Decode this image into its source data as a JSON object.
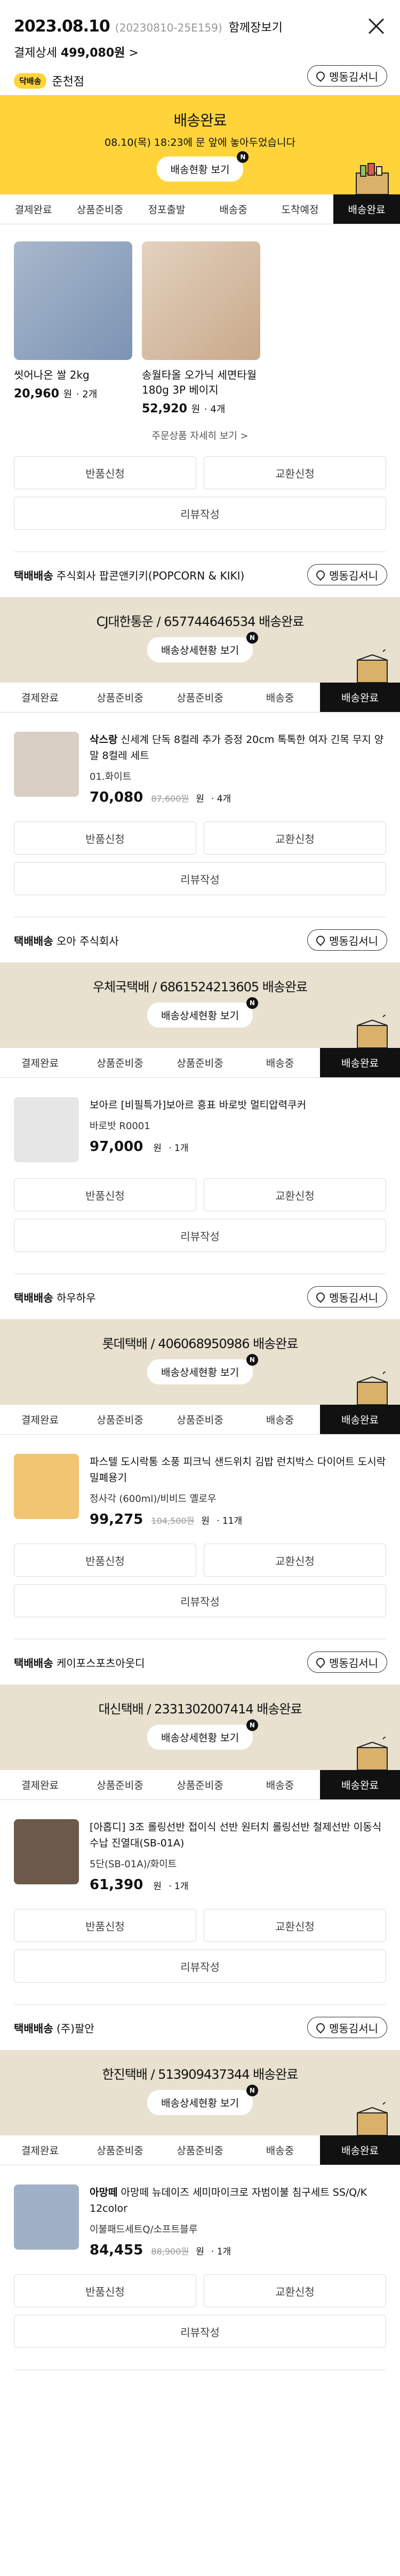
{
  "header": {
    "date": "2023.08.10",
    "order_code": "(20230810-25E159)",
    "together_link": "함께장보기",
    "pay_label": "결제상세",
    "pay_amount": "499,080원",
    "pay_arrow": ">",
    "shop_badge": "닥배송",
    "shop_name": "준천점",
    "map_btn": "멩동김서니"
  },
  "status_main": {
    "title": "배송완료",
    "desc": "08.10(목) 18:23에 문 앞에 놓아두었습니다",
    "button": "배송현황 보기",
    "badge": "N"
  },
  "tabs": [
    "결제완료",
    "상품준비중",
    "정포출발",
    "배송중",
    "도착예정",
    "배송완료"
  ],
  "store_products": [
    {
      "name": "씻어나온 쌀 2kg",
      "price": "20,960",
      "unit": "원",
      "qty": "· 2개",
      "color": "#7c93b3"
    },
    {
      "name": "송월타올 오가닉 세면타월180g 3P 베이지",
      "price": "52,920",
      "unit": "원",
      "qty": "· 4개",
      "color": "#c8a98a"
    }
  ],
  "more_link": "주문상품 자세히 보기 >",
  "actions": {
    "return": "반품신청",
    "exchange": "교환신청",
    "review": "리뷰작성"
  },
  "delivery_tabs": [
    "결제완료",
    "상품준비중",
    "상품준비중",
    "배송중",
    "배송완료"
  ],
  "shipments": [
    {
      "carrier_prefix": "택배배송",
      "carrier_name": "주식회사 팝콘앤키키(POPCORN & KIKI)",
      "status_title": "CJ대한통운 / 657744646534 배송완료",
      "status_btn": "배송상세현황 보기",
      "item_brand": "삭스랑",
      "item_name": "신세계 단독 8컬레 추가 증정 20cm 톡톡한 여자 긴목 무지 양말 8컬레 세트",
      "item_option": "01.화이트",
      "item_price": "70,080",
      "item_orig": "87,600원",
      "item_qty": "· 4개",
      "color": "#d9cfc4"
    },
    {
      "carrier_prefix": "택배배송",
      "carrier_name": "오아 주식회사",
      "status_title": "우체국택배 / 6861524213605 배송완료",
      "status_btn": "배송상세현황 보기",
      "item_brand": "",
      "item_name": "보아르 [비필특가]보아르 흥표 바로밧 멀티압력쿠커",
      "item_option": "바로밧 R0001",
      "item_price": "97,000",
      "item_orig": "",
      "item_qty": "· 1개",
      "color": "#e6e6e6"
    },
    {
      "carrier_prefix": "택배배송",
      "carrier_name": "하우하우",
      "status_title": "롯데택배 / 406068950986 배송완료",
      "status_btn": "배송상세현황 보기",
      "item_brand": "",
      "item_name": "파스텔 도시락통 소풍 피크닉 샌드위치 김밥 런치박스 다이어트 도시락 밀폐용기",
      "item_option": "정사각 (600ml)/비비드 옐로우",
      "item_price": "99,275",
      "item_orig": "104,500원",
      "item_qty": "· 11개",
      "color": "#f2c572"
    },
    {
      "carrier_prefix": "택배배송",
      "carrier_name": "케이포스포츠아웃디",
      "status_title": "대신택배 / 2331302007414 배송완료",
      "status_btn": "배송상세현황 보기",
      "item_brand": "",
      "item_name": "[아홉디] 3조 롤링선반 접이식 선반 원터치 롤링선반 철제선반 이동식 수납 진열대(SB-01A)",
      "item_option": "5단(SB-01A)/화이트",
      "item_price": "61,390",
      "item_orig": "",
      "item_qty": "· 1개",
      "color": "#6b5a4c"
    },
    {
      "carrier_prefix": "택배배송",
      "carrier_name": "(주)팔안",
      "status_title": "한진택배 / 513909437344 배송완료",
      "status_btn": "배송상세현황 보기",
      "item_brand": "아망떼",
      "item_name": "아망떼 뉴데이즈 세미마이크로 자범이불 침구세트 SS/Q/K 12color",
      "item_option": "이불패드세트Q/소프트블루",
      "item_price": "84,455",
      "item_orig": "88,900원",
      "item_qty": "· 1개",
      "color": "#9fb1c6"
    }
  ]
}
